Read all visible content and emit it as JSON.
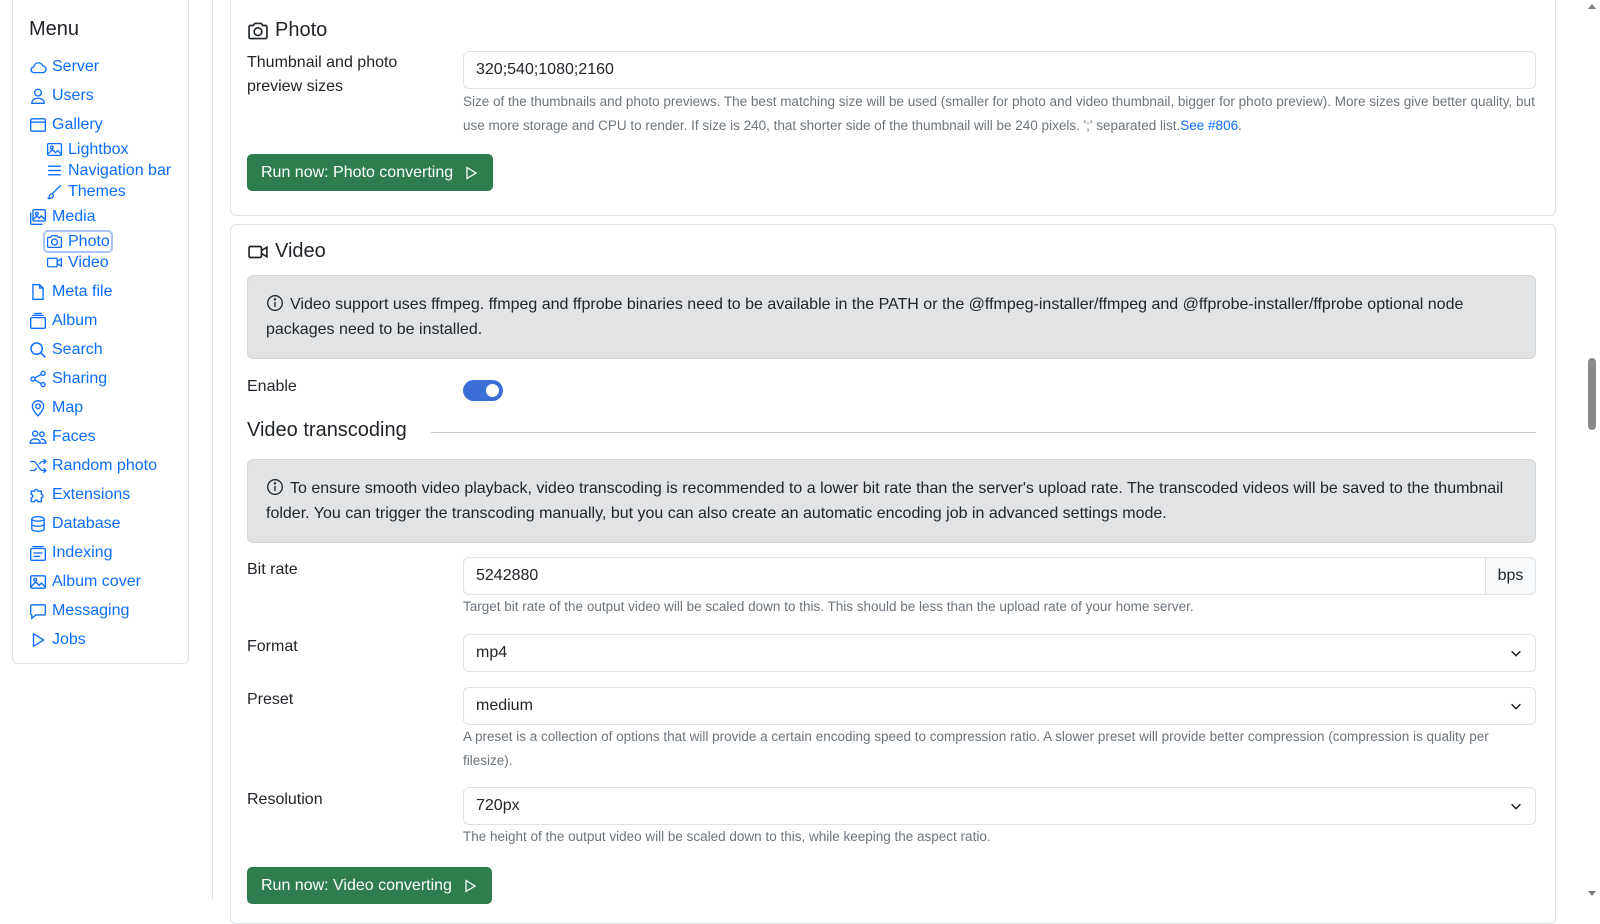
{
  "sidebar": {
    "title": "Menu",
    "items": [
      {
        "label": "Server",
        "icon": "cloud-icon"
      },
      {
        "label": "Users",
        "icon": "person-icon"
      },
      {
        "label": "Gallery",
        "icon": "window-icon"
      },
      {
        "label": "Lightbox",
        "icon": "image-icon",
        "sub": true
      },
      {
        "label": "Navigation bar",
        "icon": "list-icon",
        "sub": true
      },
      {
        "label": "Themes",
        "icon": "brush-icon",
        "sub": true
      },
      {
        "label": "Media",
        "icon": "images-icon"
      },
      {
        "label": "Photo",
        "icon": "camera-icon",
        "sub": true,
        "active": true
      },
      {
        "label": "Video",
        "icon": "video-icon",
        "sub": true
      },
      {
        "label": "Meta file",
        "icon": "file-icon"
      },
      {
        "label": "Album",
        "icon": "album-icon"
      },
      {
        "label": "Search",
        "icon": "search-icon"
      },
      {
        "label": "Sharing",
        "icon": "share-icon"
      },
      {
        "label": "Map",
        "icon": "map-pin-icon"
      },
      {
        "label": "Faces",
        "icon": "people-icon"
      },
      {
        "label": "Random photo",
        "icon": "shuffle-icon"
      },
      {
        "label": "Extensions",
        "icon": "puzzle-icon"
      },
      {
        "label": "Database",
        "icon": "database-icon"
      },
      {
        "label": "Indexing",
        "icon": "indexing-icon"
      },
      {
        "label": "Album cover",
        "icon": "image-icon"
      },
      {
        "label": "Messaging",
        "icon": "chat-icon"
      },
      {
        "label": "Jobs",
        "icon": "play-icon"
      }
    ]
  },
  "photo": {
    "title": "Photo",
    "thumb_label": "Thumbnail and photo preview sizes",
    "thumb_value": "320;540;1080;2160",
    "thumb_help": "Size of the thumbnails and photo previews. The best matching size will be used (smaller for photo and video thumbnail, bigger for photo preview). More sizes give better quality, but use more storage and CPU to render. If size is 240, that shorter side of the thumbnail will be 240 pixels. ';' separated list.",
    "thumb_help_link": "See #806",
    "thumb_help_end": ".",
    "run_label": "Run now: Photo converting"
  },
  "video": {
    "title": "Video",
    "alert": "Video support uses ffmpeg. ffmpeg and ffprobe binaries need to be available in the PATH or the @ffmpeg-installer/ffmpeg and @ffprobe-installer/ffprobe optional node packages need to be installed.",
    "enable_label": "Enable",
    "enable_value": true,
    "transcoding_title": "Video transcoding",
    "transcoding_alert": "To ensure smooth video playback, video transcoding is recommended to a lower bit rate than the server's upload rate. The transcoded videos will be saved to the thumbnail folder. You can trigger the transcoding manually, but you can also create an automatic encoding job in advanced settings mode.",
    "bitrate_label": "Bit rate",
    "bitrate_value": "5242880",
    "bitrate_unit": "bps",
    "bitrate_help": "Target bit rate of the output video will be scaled down to this. This should be less than the upload rate of your home server.",
    "format_label": "Format",
    "format_value": "mp4",
    "preset_label": "Preset",
    "preset_value": "medium",
    "preset_help": "A preset is a collection of options that will provide a certain encoding speed to compression ratio. A slower preset will provide better compression (compression is quality per filesize).",
    "resolution_label": "Resolution",
    "resolution_value": "720px",
    "resolution_help": "The height of the output video will be scaled down to this, while keeping the aspect ratio.",
    "run_label": "Run now: Video converting"
  },
  "colors": {
    "accent": "#0d6efd",
    "run_button": "#2e7d4f",
    "toggle_on": "#3b6fd8",
    "alert_bg": "#e2e3e5"
  }
}
